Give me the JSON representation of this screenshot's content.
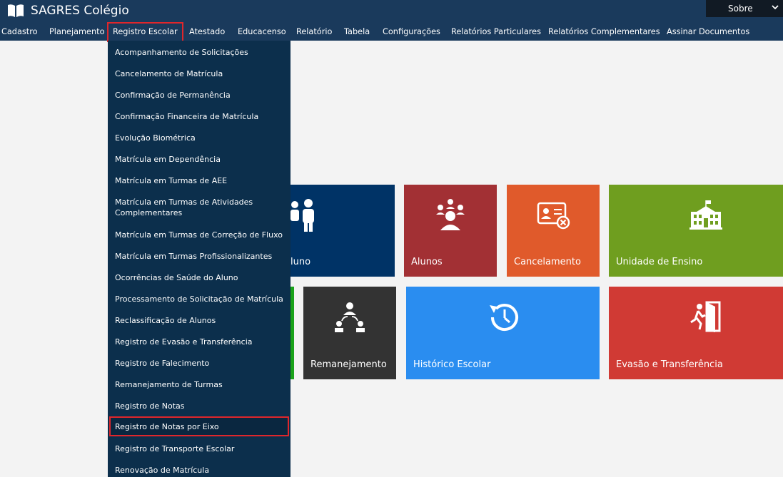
{
  "app": {
    "title": "SAGRES Colégio",
    "icon": "book-icon"
  },
  "top_right": {
    "label": "Sobre",
    "icon": "chevron-down-icon"
  },
  "nav": [
    {
      "label": "Cadastro"
    },
    {
      "label": "Planejamento"
    },
    {
      "label": "Registro Escolar",
      "active": true
    },
    {
      "label": "Atestado"
    },
    {
      "label": "Educacenso"
    },
    {
      "label": "Relatório"
    },
    {
      "label": "Tabela"
    },
    {
      "label": "Configurações"
    },
    {
      "label": "Relatórios Particulares"
    },
    {
      "label": "Relatórios Complementares"
    },
    {
      "label": "Assinar Documentos"
    }
  ],
  "dropdown": [
    {
      "label": "Acompanhamento de Solicitações"
    },
    {
      "label": "Cancelamento de Matrícula"
    },
    {
      "label": "Confirmação de Permanência"
    },
    {
      "label": "Confirmação Financeira de Matrícula"
    },
    {
      "label": "Evolução Biométrica"
    },
    {
      "label": "Matrícula em Dependência"
    },
    {
      "label": "Matrícula em Turmas de AEE"
    },
    {
      "label": "Matrícula em Turmas de Atividades Complementares"
    },
    {
      "label": "Matrícula em Turmas de Correção de Fluxo"
    },
    {
      "label": "Matrícula em Turmas Profissionalizantes"
    },
    {
      "label": "Ocorrências de Saúde do Aluno"
    },
    {
      "label": "Processamento de Solicitação de Matrícula"
    },
    {
      "label": "Reclassificação de Alunos"
    },
    {
      "label": "Registro de Evasão e Transferência"
    },
    {
      "label": "Registro de Falecimento"
    },
    {
      "label": "Remanejamento de Turmas"
    },
    {
      "label": "Registro de Notas"
    },
    {
      "label": "Registro de Notas por Eixo",
      "highlighted": true
    },
    {
      "label": "Registro de Transporte Escolar"
    },
    {
      "label": "Renovação de Matrícula"
    }
  ],
  "tiles": [
    {
      "label": "luno",
      "color": "#003366",
      "icon": "family-icon"
    },
    {
      "label": "Alunos",
      "color": "#a23034",
      "icon": "students-icon"
    },
    {
      "label": "Cancelamento",
      "color": "#e05a2b",
      "icon": "id-card-cancel-icon"
    },
    {
      "label": "Unidade de Ensino",
      "color": "#6f9e1f",
      "icon": "school-building-icon"
    },
    {
      "label": "",
      "color": "#1aa31a",
      "icon": ""
    },
    {
      "label": "Remanejamento",
      "color": "#333333",
      "icon": "transfer-people-icon"
    },
    {
      "label": "Histórico Escolar",
      "color": "#2a8df0",
      "icon": "history-clock-icon"
    },
    {
      "label": "Evasão e Transferência",
      "color": "#d03a34",
      "icon": "exit-door-icon"
    }
  ]
}
